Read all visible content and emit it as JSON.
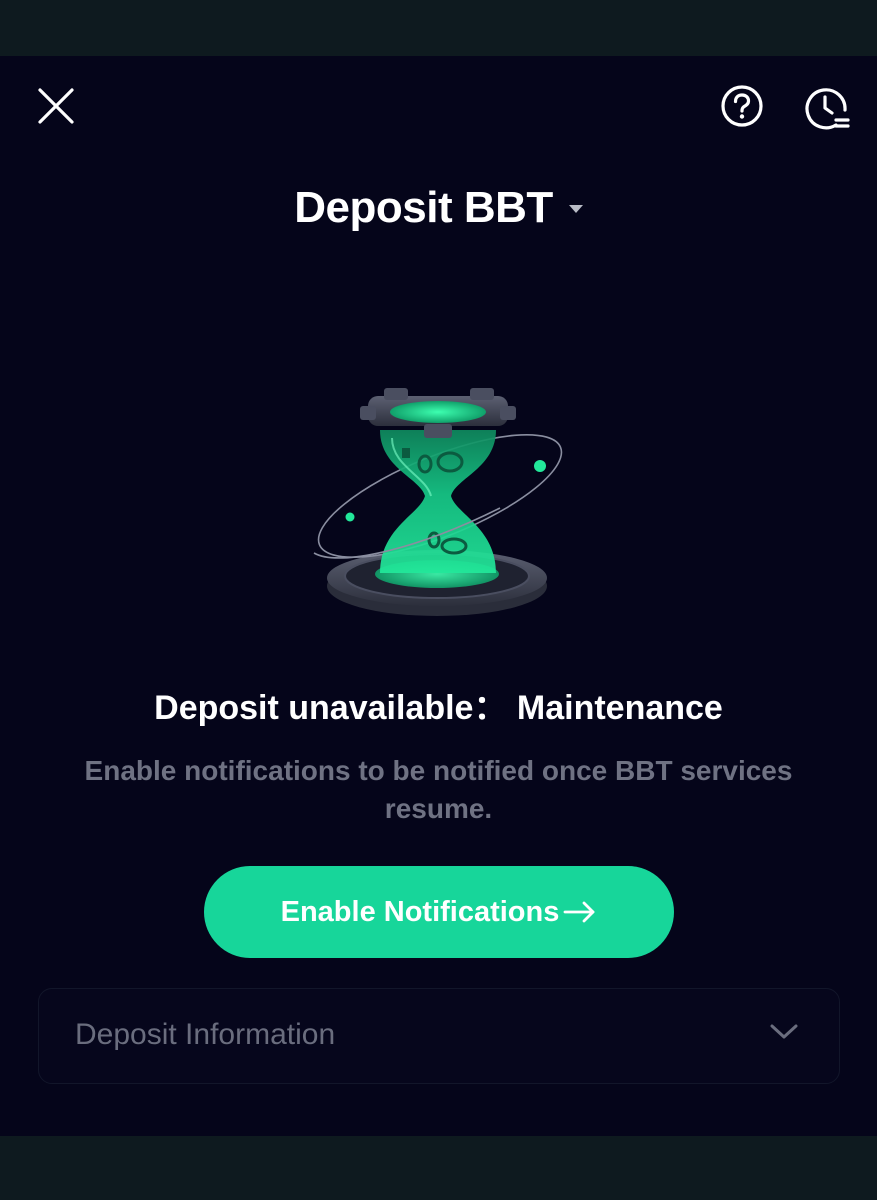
{
  "header": {
    "close_icon": "close-icon",
    "help_icon": "help-circle-icon",
    "history_icon": "history-clock-icon"
  },
  "title": {
    "text": "Deposit BBT",
    "dropdown_icon": "caret-down-icon"
  },
  "illustration": {
    "icon": "hourglass-maintenance-illustration",
    "accent_color": "#17d69a"
  },
  "status": {
    "title": "Deposit unavailable： Maintenance",
    "description": "Enable notifications to be notified once BBT services resume."
  },
  "cta": {
    "label": "Enable Notifications",
    "icon": "arrow-right-icon",
    "color": "#17d69a"
  },
  "deposit_info": {
    "label": "Deposit Information",
    "icon": "chevron-down-icon"
  },
  "colors": {
    "background": "#05051a",
    "accent": "#17d69a",
    "muted_text": "#6f7283"
  }
}
